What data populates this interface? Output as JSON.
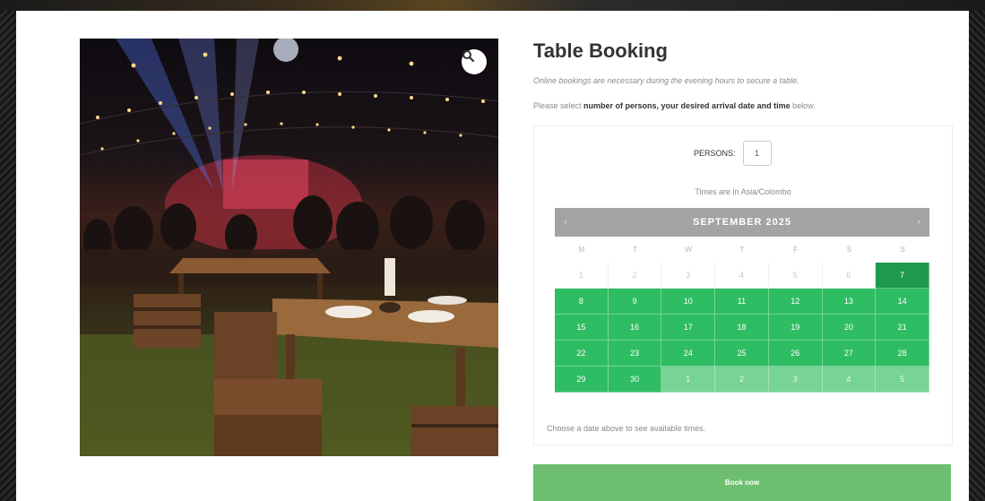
{
  "gallery": {
    "zoom_icon": "magnifier-icon"
  },
  "booking": {
    "title": "Table Booking",
    "note": "Online bookings are necessary during the evening hours to secure a table.",
    "instruction_prefix": "Please select ",
    "instruction_bold": "number of persons, your desired arrival date and time",
    "instruction_suffix": " below.",
    "persons_label": "PERSONS:",
    "persons_value": "1",
    "timezone": "Times are in Asia/Colombo",
    "choose_text": "Choose a date above to see available times.",
    "book_button": "Book now"
  },
  "calendar": {
    "month": "SEPTEMBER 2025",
    "prev": "‹",
    "next": "›",
    "weekdays": [
      "M",
      "T",
      "W",
      "T",
      "F",
      "S",
      "S"
    ],
    "days": [
      {
        "d": "1",
        "s": "past"
      },
      {
        "d": "2",
        "s": "past"
      },
      {
        "d": "3",
        "s": "past"
      },
      {
        "d": "4",
        "s": "past"
      },
      {
        "d": "5",
        "s": "past"
      },
      {
        "d": "6",
        "s": "past"
      },
      {
        "d": "7",
        "s": "today"
      },
      {
        "d": "8",
        "s": "avail"
      },
      {
        "d": "9",
        "s": "avail"
      },
      {
        "d": "10",
        "s": "avail"
      },
      {
        "d": "11",
        "s": "avail"
      },
      {
        "d": "12",
        "s": "avail"
      },
      {
        "d": "13",
        "s": "avail"
      },
      {
        "d": "14",
        "s": "avail"
      },
      {
        "d": "15",
        "s": "avail"
      },
      {
        "d": "16",
        "s": "avail"
      },
      {
        "d": "17",
        "s": "avail"
      },
      {
        "d": "18",
        "s": "avail"
      },
      {
        "d": "19",
        "s": "avail"
      },
      {
        "d": "20",
        "s": "avail"
      },
      {
        "d": "21",
        "s": "avail"
      },
      {
        "d": "22",
        "s": "avail"
      },
      {
        "d": "23",
        "s": "avail"
      },
      {
        "d": "24",
        "s": "avail"
      },
      {
        "d": "25",
        "s": "avail"
      },
      {
        "d": "26",
        "s": "avail"
      },
      {
        "d": "27",
        "s": "avail"
      },
      {
        "d": "28",
        "s": "avail"
      },
      {
        "d": "29",
        "s": "avail"
      },
      {
        "d": "30",
        "s": "avail"
      },
      {
        "d": "1",
        "s": "next"
      },
      {
        "d": "2",
        "s": "next"
      },
      {
        "d": "3",
        "s": "next"
      },
      {
        "d": "4",
        "s": "next"
      },
      {
        "d": "5",
        "s": "next"
      }
    ]
  },
  "colors": {
    "available": "#2fbd63",
    "today": "#1e9a4c",
    "next_month": "#77d495",
    "header": "#a3a3a3",
    "book_button": "#6dbf6f"
  }
}
